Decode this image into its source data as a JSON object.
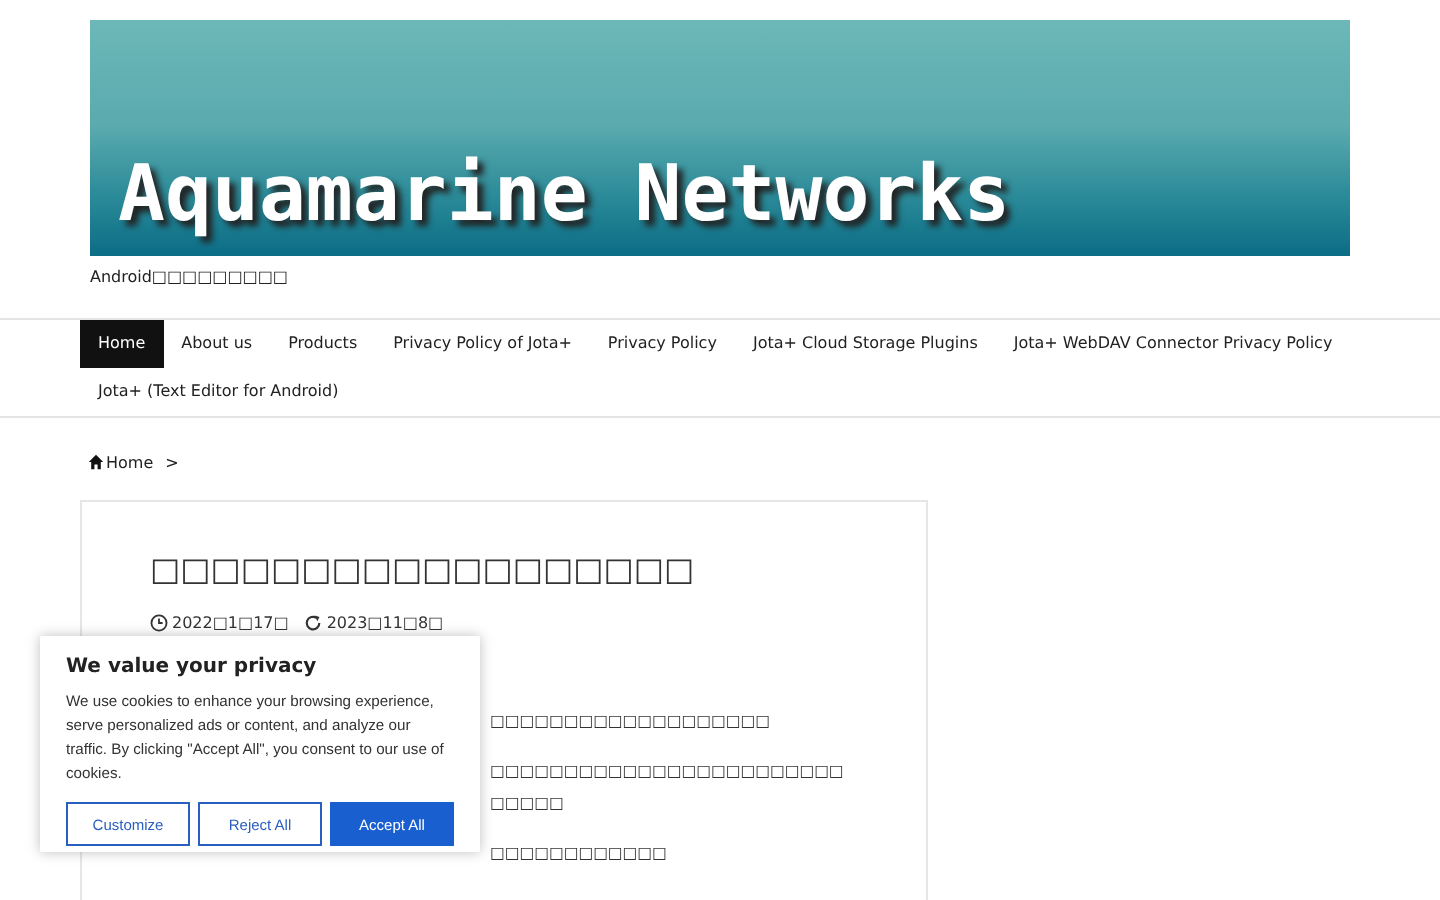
{
  "site": {
    "title": "Aquamarine Networks",
    "tagline": "Android□□□□□□□□□"
  },
  "nav": [
    {
      "label": "Home",
      "selected": true
    },
    {
      "label": "About us",
      "selected": false
    },
    {
      "label": "Products",
      "selected": false
    },
    {
      "label": "Privacy Policy of Jota+",
      "selected": false
    },
    {
      "label": "Privacy Policy",
      "selected": false
    },
    {
      "label": "Jota+ Cloud Storage Plugins",
      "selected": false
    },
    {
      "label": "Jota+ WebDAV Connector Privacy Policy",
      "selected": false
    },
    {
      "label": "Jota+ (Text Editor for Android)",
      "selected": false
    }
  ],
  "breadcrumb": {
    "home": "Home",
    "separator": ">"
  },
  "article": {
    "title": "□□□□□□□□□□□□□□□□□□",
    "published": "2022□1□17□",
    "updated": "2023□11□8□",
    "paragraphs": [
      "□□□□□□□□□□□□□□□□□□□",
      "□□□□□□□□□□□□□□□□□□□□□□□□□□□□□",
      "□□□□□□□□□□□□"
    ]
  },
  "cookie": {
    "title": "We value your privacy",
    "text": "We use cookies to enhance your browsing experience, serve personalized ads or content, and analyze our traffic. By clicking \"Accept All\", you consent to our use of cookies.",
    "buttons": [
      {
        "label": "Customize",
        "kind": "outline"
      },
      {
        "label": "Reject All",
        "kind": "outline"
      },
      {
        "label": "Accept All",
        "kind": "primary"
      }
    ]
  }
}
